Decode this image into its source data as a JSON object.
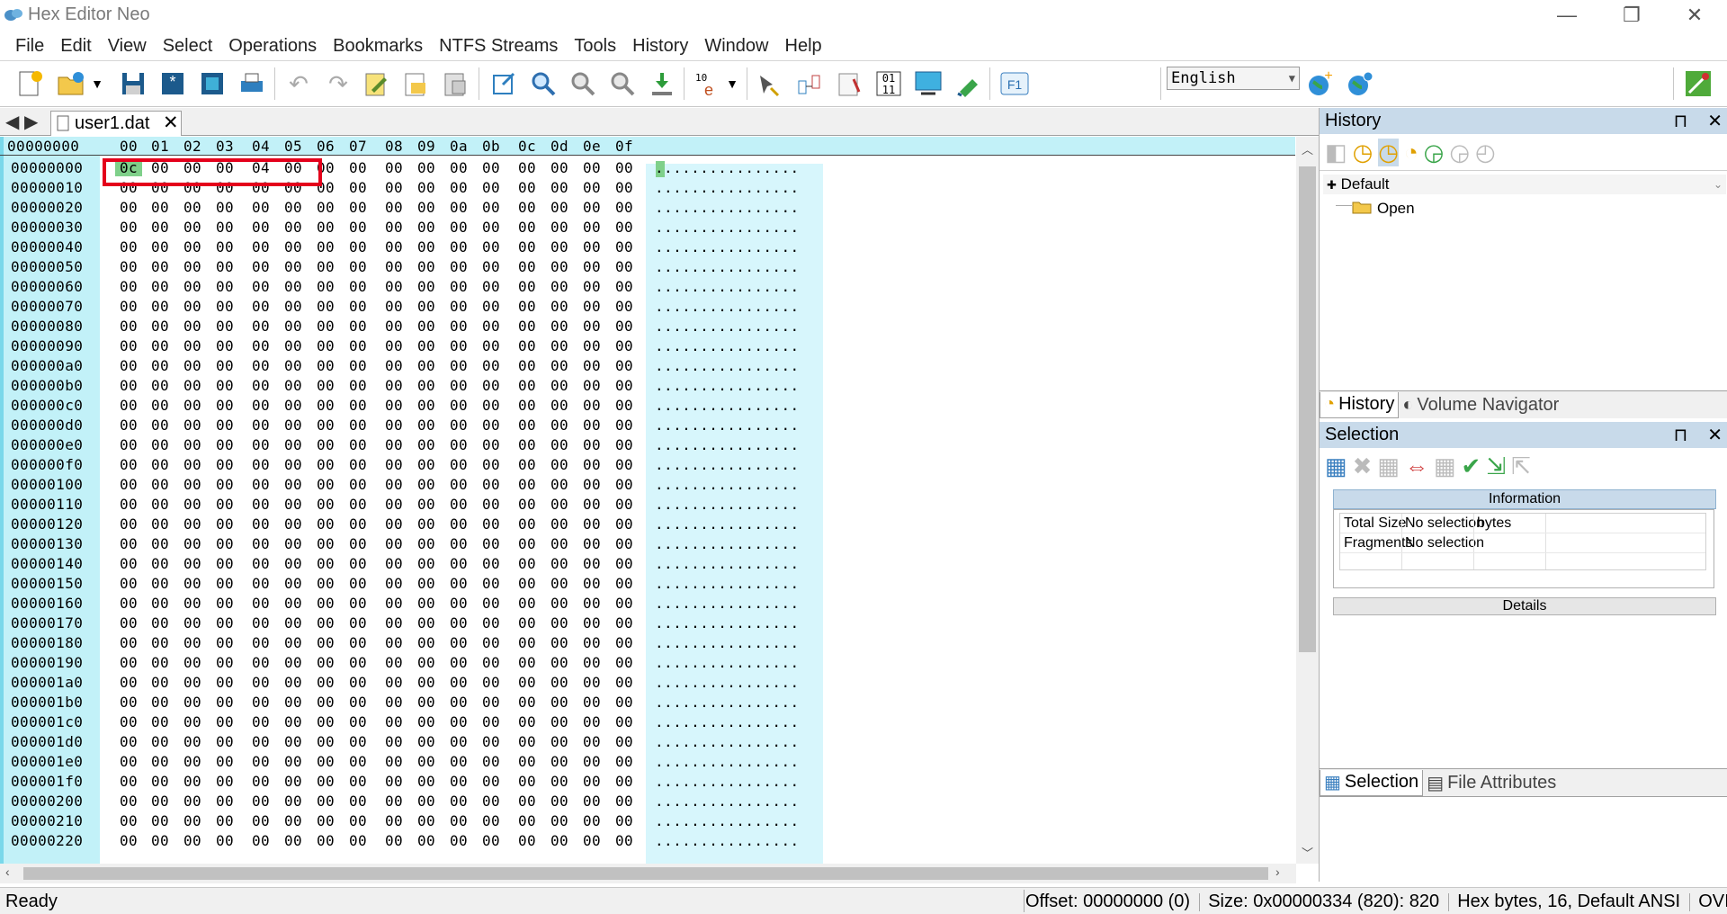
{
  "window": {
    "title": "Hex Editor Neo",
    "minimize": "—",
    "restore": "❐",
    "close": "✕"
  },
  "menu": [
    "File",
    "Edit",
    "View",
    "Select",
    "Operations",
    "Bookmarks",
    "NTFS Streams",
    "Tools",
    "History",
    "Window",
    "Help"
  ],
  "toolbar": {
    "language": "English",
    "icons": [
      "new-file",
      "open-file",
      "save",
      "save-all",
      "save-as",
      "print",
      "undo",
      "redo",
      "edit-block",
      "copy-to",
      "paste-from",
      "export",
      "find",
      "find-next",
      "find-previous",
      "go-to",
      "insert-pattern",
      "bookmark",
      "fill",
      "compare",
      "bit-mode",
      "data-inspector",
      "about",
      "help"
    ]
  },
  "tab": {
    "filename": "user1.dat",
    "close": "✕"
  },
  "hex": {
    "offset_header": "00000000",
    "columns": [
      "00",
      "01",
      "02",
      "03",
      "04",
      "05",
      "06",
      "07",
      "08",
      "09",
      "0a",
      "0b",
      "0c",
      "0d",
      "0e",
      "0f"
    ],
    "first_row_bytes": [
      "0c",
      "00",
      "00",
      "00",
      "04",
      "00",
      "00",
      "00",
      "00",
      "00",
      "00",
      "00",
      "00",
      "00",
      "00",
      "00"
    ],
    "zero_byte": "00",
    "offsets": [
      "00000000",
      "00000010",
      "00000020",
      "00000030",
      "00000040",
      "00000050",
      "00000060",
      "00000070",
      "00000080",
      "00000090",
      "000000a0",
      "000000b0",
      "000000c0",
      "000000d0",
      "000000e0",
      "000000f0",
      "00000100",
      "00000110",
      "00000120",
      "00000130",
      "00000140",
      "00000150",
      "00000160",
      "00000170",
      "00000180",
      "00000190",
      "000001a0",
      "000001b0",
      "000001c0",
      "000001d0",
      "000001e0",
      "000001f0",
      "00000200",
      "00000210",
      "00000220"
    ],
    "ascii_row": "................"
  },
  "history_panel": {
    "title": "History",
    "pin": "⊓",
    "close": "✕",
    "group": "Default",
    "item": "Open",
    "tabs": [
      "History",
      "Volume Navigator"
    ]
  },
  "selection_panel": {
    "title": "Selection",
    "pin": "⊓",
    "close": "✕",
    "information_header": "Information",
    "rows": [
      {
        "label": "Total Size",
        "value": "No selection",
        "unit": "bytes"
      },
      {
        "label": "Fragments",
        "value": "No selection",
        "unit": ""
      }
    ],
    "details_header": "Details",
    "tabs": [
      "Selection",
      "File Attributes"
    ]
  },
  "status": {
    "left": "Ready",
    "offset": "Offset: 00000000 (0)",
    "size": "Size: 0x00000334 (820): 820",
    "mode": "Hex bytes, 16, Default ANSI",
    "ovr": "OVI"
  },
  "colors": {
    "offset_bg": "#c2f1f8",
    "ascii_bg": "#d7f6fc",
    "selection": "#7fd08a",
    "highlight_box": "#e4001b",
    "panel_header": "#c8daea"
  }
}
